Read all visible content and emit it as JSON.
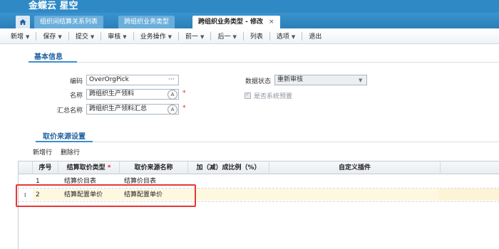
{
  "app": {
    "brand": "金蝶云 星空",
    "brand_sub": ""
  },
  "tabs": [
    {
      "label": "组织间结算关系列表"
    },
    {
      "label": "跨组织业务类型"
    },
    {
      "label": "跨组织业务类型 - 修改",
      "close": "×"
    }
  ],
  "toolbar": {
    "items": [
      {
        "label": "新增",
        "caret": "▼"
      },
      {
        "label": "保存",
        "caret": "▼"
      },
      {
        "label": "提交",
        "caret": "▼"
      },
      {
        "label": "审核",
        "caret": "▼"
      },
      {
        "label": "业务操作",
        "caret": "▼"
      },
      {
        "label": "前一",
        "caret": "▼"
      },
      {
        "label": "后一",
        "caret": "▼"
      },
      {
        "label": "列表",
        "caret": ""
      },
      {
        "label": "选项",
        "caret": "▼"
      },
      {
        "label": "退出",
        "caret": ""
      }
    ]
  },
  "basic": {
    "title": "基本信息",
    "code_label": "编码",
    "code_value": "OverOrgPick",
    "code_btn": "···",
    "name_label": "名称",
    "name_value": "跨组织生产领料",
    "summary_label": "汇总名称",
    "summary_value": "跨组织生产领料汇总",
    "status_label": "数据状态",
    "status_value": "重新审核",
    "preset_label": "是否系统预置",
    "required_mark": "*"
  },
  "price": {
    "title": "取价来源设置",
    "add_row": "新增行",
    "delete_row": "删除行",
    "columns": [
      "序号",
      "结算取价类型",
      "*",
      "取价来源名称",
      "加（减）成比例（%）",
      "自定义插件"
    ],
    "rows": [
      {
        "seq": "1",
        "type": "结算价目表",
        "source": "结算价目表"
      },
      {
        "seq": "2",
        "type": "结算配置单价",
        "source": "结算配置单价"
      }
    ],
    "cursor": "I"
  },
  "colors": {
    "accent": "#2f89c5",
    "highlight_box": "#e53935",
    "required": "#d9262c"
  }
}
